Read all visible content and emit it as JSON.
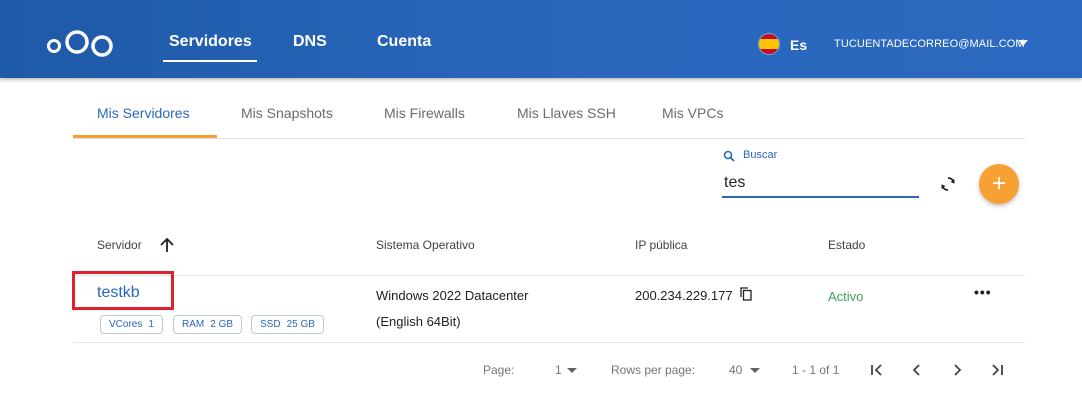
{
  "header": {
    "logo_icon": "nextcloud-logo-icon",
    "nav": [
      {
        "label": "Servidores",
        "active": true
      },
      {
        "label": "DNS",
        "active": false
      },
      {
        "label": "Cuenta",
        "active": false
      }
    ],
    "language": "Es",
    "flag_icon": "spain-flag-icon",
    "account_email": "TUCUENTADECORREO@MAIL.COM"
  },
  "tabs": [
    {
      "label": "Mis Servidores",
      "active": true
    },
    {
      "label": "Mis Snapshots",
      "active": false
    },
    {
      "label": "Mis Firewalls",
      "active": false
    },
    {
      "label": "Mis Llaves SSH",
      "active": false
    },
    {
      "label": "Mis VPCs",
      "active": false
    }
  ],
  "search": {
    "label": "Buscar",
    "value": "tes"
  },
  "table": {
    "headers": [
      "Servidor",
      "Sistema Operativo",
      "IP pública",
      "Estado"
    ],
    "sort": "ascending",
    "rows": [
      {
        "name": "testkb",
        "chips": [
          {
            "label": "VCores",
            "value": "1"
          },
          {
            "label": "RAM",
            "value": "2 GB"
          },
          {
            "label": "SSD",
            "value": "25 GB"
          }
        ],
        "os_line1": "Windows 2022 Datacenter",
        "os_line2": "(English 64Bit)",
        "ip": "200.234.229.177",
        "status": "Activo"
      }
    ]
  },
  "pagination": {
    "page_label": "Page:",
    "page_value": "1",
    "rows_label": "Rows per page:",
    "rows_value": "40",
    "range": "1 - 1 of 1"
  },
  "colors": {
    "primary": "#2a67bd",
    "accent": "#f7a134",
    "success": "#3da05a",
    "highlight": "#e0202a"
  }
}
